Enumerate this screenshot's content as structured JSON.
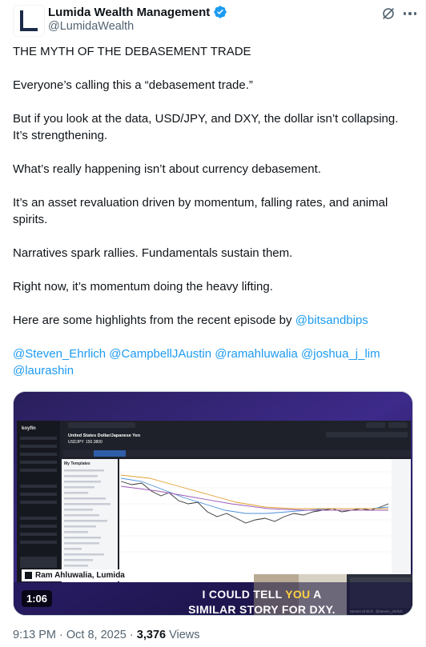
{
  "author": {
    "display_name": "Lumida Wealth Management",
    "handle": "@LumidaWealth"
  },
  "tweet": {
    "paragraphs": [
      "THE MYTH OF THE DEBASEMENT TRADE",
      "Everyone’s calling this a “debasement trade.”",
      "But if you look at the data, USD/JPY, and DXY, the dollar isn’t collapsing. It’s strengthening.",
      "What’s really happening isn’t about currency debasement.",
      "It’s an asset revaluation driven by momentum, falling rates, and animal spirits.",
      "Narratives spark rallies. Fundamentals sustain them.",
      "Right now, it’s momentum doing the heavy lifting."
    ],
    "highlights_text": "Here are some highlights from the recent episode by ",
    "highlights_mention": "@bitsandbips",
    "mentions": [
      "@Steven_Ehrlich",
      "@CampbellJAustin",
      "@ramahluwalia",
      "@joshua_j_lim",
      "@laurashin"
    ]
  },
  "video": {
    "duration": "1:06",
    "caption_line1_a": "I COULD TELL ",
    "caption_line1_b": "YOU",
    "caption_line1_c": " A",
    "caption_line2": "SIMILAR STORY FOR DXY.",
    "nameplate": "Ram Ahluwalia, Lumida",
    "embedded": {
      "app_name": "koyfin",
      "security_title": "United States Dollar/Japanese Yen",
      "ticker": "USDJPY",
      "price": "150.3800",
      "panel_title": "My Templates",
      "guest_name": "Steven Ehrlich",
      "guest_handle": "@steven_ehrlich"
    }
  },
  "meta": {
    "time": "9:13 PM",
    "date": "Oct 8, 2025",
    "separator": "·",
    "views_count": "3,376",
    "views_label": "Views"
  },
  "colors": {
    "accent": "#1d9bf0",
    "text": "#0f1419",
    "secondary": "#536471",
    "caption_highlight": "#ffd23f"
  }
}
